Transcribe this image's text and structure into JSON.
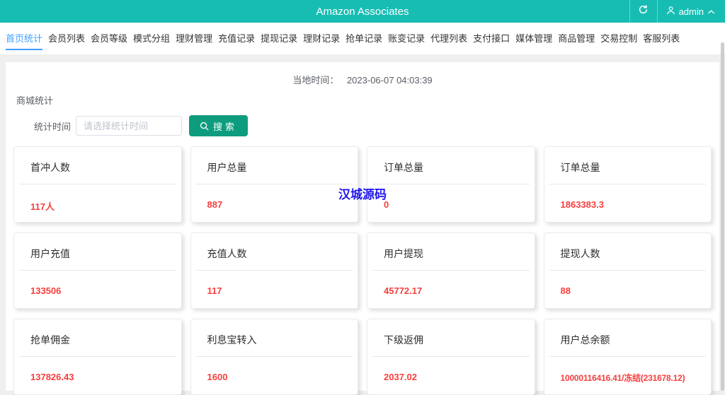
{
  "header": {
    "title": "Amazon Associates",
    "user_name": "admin"
  },
  "nav": {
    "tabs": [
      {
        "id": "home-stats",
        "label": "首页统计",
        "active": true
      },
      {
        "id": "member-list",
        "label": "会员列表",
        "active": false
      },
      {
        "id": "member-level",
        "label": "会员等级",
        "active": false
      },
      {
        "id": "mode-group",
        "label": "模式分组",
        "active": false
      },
      {
        "id": "finance-mgmt",
        "label": "理财管理",
        "active": false
      },
      {
        "id": "recharge-records",
        "label": "充值记录",
        "active": false
      },
      {
        "id": "withdraw-records",
        "label": "提现记录",
        "active": false
      },
      {
        "id": "finance-records",
        "label": "理财记录",
        "active": false
      },
      {
        "id": "order-grab-records",
        "label": "抢单记录",
        "active": false
      },
      {
        "id": "balance-change-records",
        "label": "账变记录",
        "active": false
      },
      {
        "id": "agent-list",
        "label": "代理列表",
        "active": false
      },
      {
        "id": "payment-api",
        "label": "支付接口",
        "active": false
      },
      {
        "id": "media-mgmt",
        "label": "媒体管理",
        "active": false
      },
      {
        "id": "product-mgmt",
        "label": "商品管理",
        "active": false
      },
      {
        "id": "trade-control",
        "label": "交易控制",
        "active": false
      },
      {
        "id": "service-list",
        "label": "客服列表",
        "active": false
      }
    ]
  },
  "toolbar": {
    "local_time_label": "当地时间：",
    "local_time_value": "2023-06-07 04:03:39",
    "section_title": "商城统计",
    "time_filter_label": "统计时间",
    "time_filter_placeholder": "请选择统计时间",
    "time_filter_value": "",
    "search_label": "搜索"
  },
  "watermark_text": "汉城源码",
  "stats": {
    "cards": [
      {
        "title": "首冲人数",
        "value": "117人"
      },
      {
        "title": "用户总量",
        "value": "887"
      },
      {
        "title": "订单总量",
        "value": "0"
      },
      {
        "title": "订单总量",
        "value": "1863383.3"
      },
      {
        "title": "用户充值",
        "value": "133506"
      },
      {
        "title": "充值人数",
        "value": "117"
      },
      {
        "title": "用户提现",
        "value": "45772.17"
      },
      {
        "title": "提现人数",
        "value": "88"
      },
      {
        "title": "抢单佣金",
        "value": "137826.43"
      },
      {
        "title": "利息宝转入",
        "value": "1600"
      },
      {
        "title": "下级返佣",
        "value": "2037.02"
      },
      {
        "title": "用户总余额",
        "value": "10000116416.41/冻结(231678.12)"
      }
    ]
  },
  "colors": {
    "header_teal": "#17bdb3",
    "button_green": "#0e9c7e",
    "active_tab_blue": "#409eff",
    "value_red": "#f83e3e",
    "watermark_blue": "#2016f0"
  }
}
